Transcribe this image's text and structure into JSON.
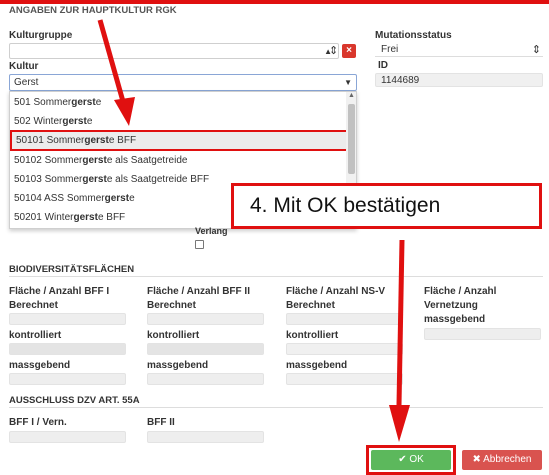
{
  "hauptkultur": {
    "section_title": "ANGABEN ZUR HAUPTKULTUR RGK",
    "kulturgruppe_label": "Kulturgruppe",
    "kulturgruppe_value": "",
    "clear_label": "×",
    "kultur_label": "Kultur",
    "kultur_value": "Gerst",
    "mutationsstatus_label": "Mutationsstatus",
    "mutationsstatus_value": "Frei",
    "id_label": "ID",
    "id_value": "1144689",
    "verlang_label": "Verlang"
  },
  "dropdown": {
    "items": [
      {
        "pre": "501 Sommer",
        "match": "gerst",
        "post": "e"
      },
      {
        "pre": "502 Winter",
        "match": "gerst",
        "post": "e"
      },
      {
        "pre": "50101 Sommer",
        "match": "gerst",
        "post": "e BFF"
      },
      {
        "pre": "50102 Sommer",
        "match": "gerst",
        "post": "e als Saatgetreide"
      },
      {
        "pre": "50103 Sommer",
        "match": "gerst",
        "post": "e als Saatgetreide BFF"
      },
      {
        "pre": "50104 ASS Sommer",
        "match": "gerst",
        "post": "e"
      },
      {
        "pre": "50201 Winter",
        "match": "gerst",
        "post": "e BFF"
      }
    ],
    "highlighted_index": 2
  },
  "annotation": {
    "callout_text": "4. Mit OK bestätigen",
    "color": "#e01010"
  },
  "biodiversitaet": {
    "section_title": "BIODIVERSITÄTSFLÄCHEN",
    "columns": [
      {
        "header": "Fläche / Anzahl BFF I",
        "sub": "Berechnet",
        "kontrolliert": "kontrolliert",
        "massgebend": "massgebend"
      },
      {
        "header": "Fläche / Anzahl BFF II",
        "sub": "Berechnet",
        "kontrolliert": "kontrolliert",
        "massgebend": "massgebend"
      },
      {
        "header": "Fläche / Anzahl NS-V",
        "sub": "Berechnet",
        "kontrolliert": "kontrolliert",
        "massgebend": "massgebend"
      },
      {
        "header": "Fläche / Anzahl",
        "sub": "Vernetzung",
        "massgebend": "massgebend"
      }
    ]
  },
  "ausschluss": {
    "section_title": "AUSSCHLUSS DZV ART. 55A",
    "col1_label": "BFF I / Vern.",
    "col2_label": "BFF II"
  },
  "footer": {
    "ok_label": "OK",
    "cancel_label": "Abbrechen",
    "ok_color": "#5cb85c",
    "cancel_color": "#d9534f"
  }
}
